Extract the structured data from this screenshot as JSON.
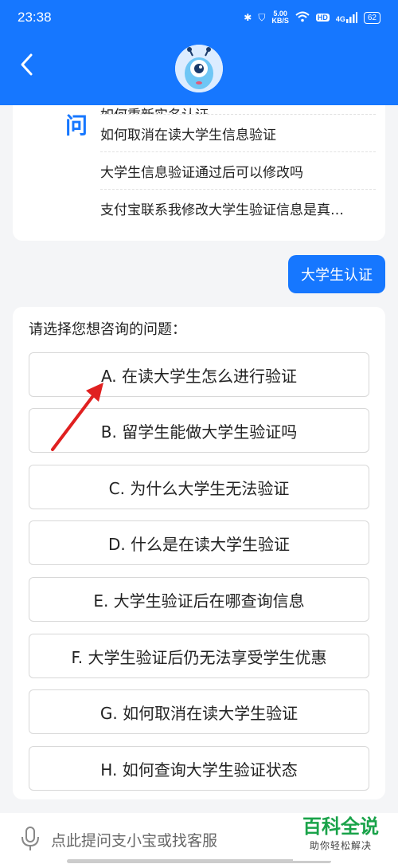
{
  "status_bar": {
    "time": "23:38",
    "net_speed_value": "5.00",
    "net_speed_unit": "KB/S",
    "hd_label": "HD",
    "signal_label": "4G",
    "battery": "62"
  },
  "faq": {
    "items": [
      "如何重新实名认证",
      "如何取消在读大学生信息验证",
      "大学生信息验证通过后可以修改吗",
      "支付宝联系我修改大学生验证信息是真…"
    ],
    "deco_char": "问"
  },
  "user_message": "大学生认证",
  "options": {
    "prompt": "请选择您想咨询的问题：",
    "items": [
      "A. 在读大学生怎么进行验证",
      "B. 留学生能做大学生验证吗",
      "C. 为什么大学生无法验证",
      "D. 什么是在读大学生验证",
      "E. 大学生验证后在哪查询信息",
      "F. 大学生验证后仍无法享受学生优惠",
      "G. 如何取消在读大学生验证",
      "H. 如何查询大学生验证状态"
    ]
  },
  "input": {
    "placeholder": "点此提问支小宝或找客服"
  },
  "watermark": {
    "title": "百科全说",
    "subtitle": "助你轻松解决"
  },
  "colors": {
    "brand": "#1677ff",
    "annotation": "#e02020",
    "watermark": "#1aa34a"
  }
}
